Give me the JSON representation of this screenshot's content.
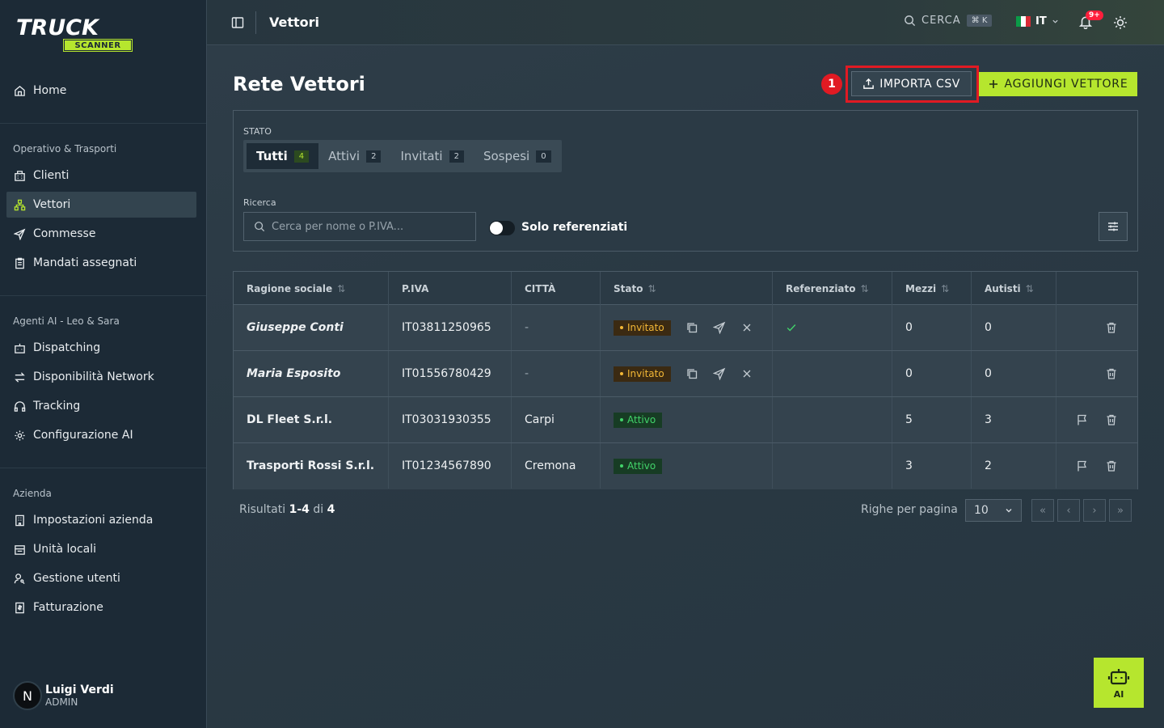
{
  "brand": {
    "top": "TRUCK",
    "bottom": "SCANNER",
    "accent": "#b6e62e"
  },
  "sidebar": {
    "home": "Home",
    "sections": [
      {
        "title": "Operativo & Trasporti",
        "items": [
          "Clienti",
          "Vettori",
          "Commesse",
          "Mandati assegnati"
        ]
      },
      {
        "title": "Agenti AI - Leo & Sara",
        "items": [
          "Dispatching",
          "Disponibilità Network",
          "Tracking",
          "Configurazione AI"
        ]
      },
      {
        "title": "Azienda",
        "items": [
          "Impostazioni azienda",
          "Unità locali",
          "Gestione utenti",
          "Fatturazione"
        ]
      }
    ],
    "active": "Vettori",
    "user": {
      "initial": "N",
      "name": "Luigi Verdi",
      "role": "ADMIN"
    }
  },
  "topbar": {
    "title": "Vettori",
    "search_label": "CERCA",
    "shortcut": "⌘ K",
    "lang": "IT",
    "notifications": "9+"
  },
  "page": {
    "title": "Rete Vettori",
    "annotation": "1",
    "import_label": "IMPORTA CSV",
    "add_label": "AGGIUNGI VETTORE"
  },
  "filters": {
    "status_label": "STATO",
    "tabs": [
      {
        "label": "Tutti",
        "count": "4"
      },
      {
        "label": "Attivi",
        "count": "2"
      },
      {
        "label": "Invitati",
        "count": "2"
      },
      {
        "label": "Sospesi",
        "count": "0"
      }
    ],
    "search_label": "Ricerca",
    "search_placeholder": "Cerca per nome o P.IVA...",
    "toggle_label": "Solo referenziati"
  },
  "table": {
    "headers": [
      "Ragione sociale",
      "P.IVA",
      "CITTÀ",
      "Stato",
      "Referenziato",
      "Mezzi",
      "Autisti"
    ],
    "rows": [
      {
        "name": "Giuseppe Conti",
        "piva": "IT03811250965",
        "city": "-",
        "status": "Invitato",
        "ref": true,
        "mezzi": "0",
        "autisti": "0"
      },
      {
        "name": "Maria Esposito",
        "piva": "IT01556780429",
        "city": "-",
        "status": "Invitato",
        "ref": false,
        "mezzi": "0",
        "autisti": "0"
      },
      {
        "name": "DL Fleet S.r.l.",
        "piva": "IT03031930355",
        "city": "Carpi",
        "status": "Attivo",
        "ref": false,
        "mezzi": "5",
        "autisti": "3"
      },
      {
        "name": "Trasporti Rossi S.r.l.",
        "piva": "IT01234567890",
        "city": "Cremona",
        "status": "Attivo",
        "ref": false,
        "mezzi": "3",
        "autisti": "2"
      }
    ]
  },
  "pagination": {
    "results_prefix": "Risultati",
    "range": "1-4",
    "of": "di",
    "total": "4",
    "rpp_label": "Righe per pagina",
    "rpp_value": "10"
  },
  "ai_button": "AI"
}
